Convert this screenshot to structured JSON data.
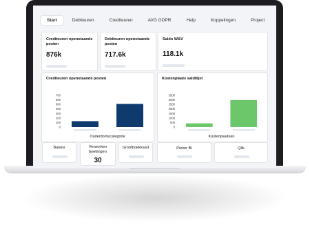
{
  "tabs": [
    {
      "label": "Start",
      "active": true
    },
    {
      "label": "Debiteuren",
      "active": false
    },
    {
      "label": "Crediteuren",
      "active": false
    },
    {
      "label": "AVG GDPR",
      "active": false
    },
    {
      "label": "Help",
      "active": false
    },
    {
      "label": "Koppelingen",
      "active": false
    },
    {
      "label": "Project",
      "active": false
    }
  ],
  "kpis": [
    {
      "title": "Crediteuren openstaande\nposten",
      "value": "876k"
    },
    {
      "title": "Debiteuren openstaande\nposten",
      "value": "717.6k"
    },
    {
      "title": "Saldo W&V",
      "value": "118.1k"
    }
  ],
  "chart_data": [
    {
      "type": "bar",
      "title": "Crediteuren openstaande posten",
      "xlabel": "Ouderdomscategorie",
      "ylabel": "",
      "ylim": [
        0,
        700
      ],
      "yticks": [
        0,
        100,
        200,
        300,
        400,
        500,
        600,
        700
      ],
      "categories": [
        "",
        ""
      ],
      "values": [
        130,
        510
      ],
      "color": "#0e3a6e",
      "grid": false
    },
    {
      "type": "bar",
      "title": "Kostenplaats saldilijst",
      "xlabel": "Kostenplaatsen",
      "ylabel": "",
      "ylim": [
        0,
        3500
      ],
      "yticks": [
        0,
        500,
        1000,
        1500,
        2000,
        2500,
        3000,
        3500
      ],
      "categories": [
        "",
        ""
      ],
      "values": [
        410,
        2980
      ],
      "color": "#6cc76a",
      "grid": false
    }
  ],
  "tiles": [
    {
      "label": "Balans",
      "value": ""
    },
    {
      "label": "Verwerken\nboekingen",
      "value": "30"
    },
    {
      "label": "Grootboekkaart",
      "value": ""
    },
    {
      "label": "Power BI",
      "value": ""
    },
    {
      "label": "Qlik",
      "value": ""
    }
  ]
}
